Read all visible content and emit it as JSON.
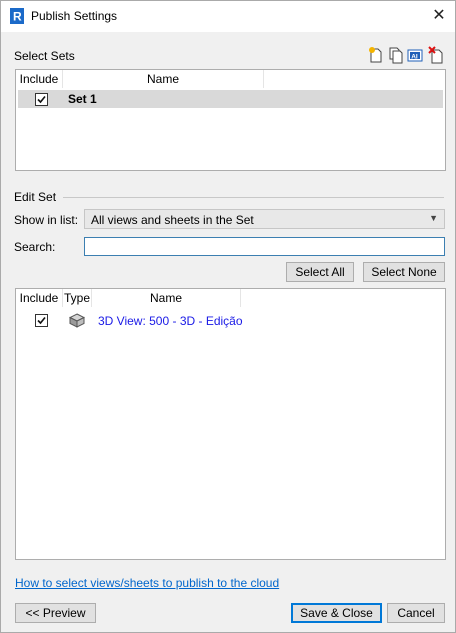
{
  "window": {
    "title": "Publish Settings",
    "close_glyph": "✕"
  },
  "select_sets": {
    "heading": "Select Sets",
    "toolbar_icons": [
      "new-set-icon",
      "copy-set-icon",
      "rename-set-icon",
      "delete-set-icon"
    ],
    "columns": {
      "include": "Include",
      "name": "Name"
    },
    "rows": [
      {
        "checked": true,
        "name": "Set 1",
        "selected": true
      }
    ]
  },
  "edit_set": {
    "heading": "Edit Set",
    "show_in_list_label": "Show in list:",
    "show_in_list_value": "All views and sheets in the Set",
    "search_label": "Search:",
    "search_value": "",
    "select_all_label": "Select All",
    "select_none_label": "Select None",
    "columns": {
      "include": "Include",
      "type": "Type",
      "name": "Name"
    },
    "rows": [
      {
        "checked": true,
        "type_icon": "3d-view-icon",
        "name": "3D View: 500 - 3D - Edição"
      }
    ]
  },
  "footer": {
    "help_link": "How to select views/sheets to publish to the cloud",
    "preview_label": "<< Preview",
    "save_close_label": "Save & Close",
    "cancel_label": "Cancel"
  },
  "colors": {
    "accent": "#0078d7",
    "link": "#0066cc",
    "row_name": "#1a1ae6"
  }
}
